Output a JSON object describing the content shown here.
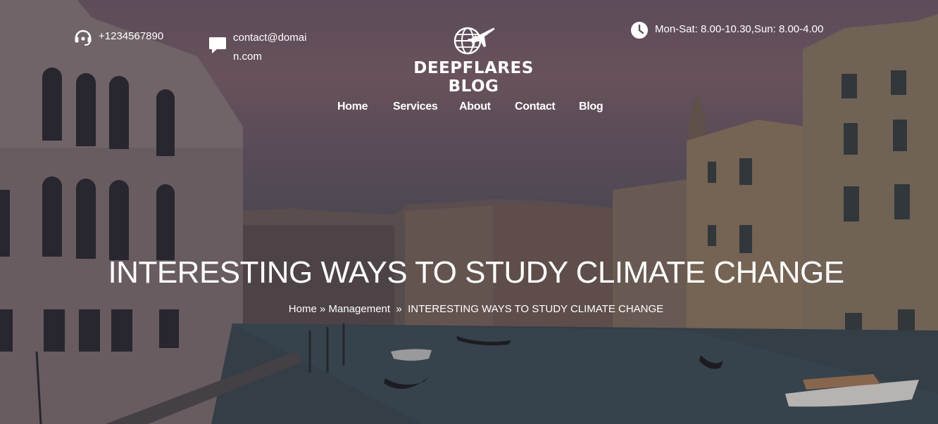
{
  "topbar": {
    "phone": "+1234567890",
    "email": "contact@domain.com",
    "hours": "Mon-Sat: 8.00-10.30,Sun: 8.00-4.00",
    "icons": [
      "headset-icon",
      "chat-icon",
      "clock-icon"
    ]
  },
  "logo": {
    "title": "DEEPFLARES BLOG",
    "icon": "globe-airplane-icon"
  },
  "nav": {
    "items": [
      {
        "label": "Home"
      },
      {
        "label": "Services"
      },
      {
        "label": "About"
      },
      {
        "label": "Contact"
      },
      {
        "label": "Blog"
      }
    ]
  },
  "page": {
    "title": "INTERESTING WAYS TO STUDY CLIMATE CHANGE"
  },
  "breadcrumb": {
    "home": "Home",
    "sep1": " » ",
    "category": "Management",
    "sep2": "  »  ",
    "current": "INTERESTING WAYS TO STUDY CLIMATE CHANGE"
  },
  "colors": {
    "text": "#ffffff",
    "sky": "#6d5868",
    "water": "#36424e"
  }
}
